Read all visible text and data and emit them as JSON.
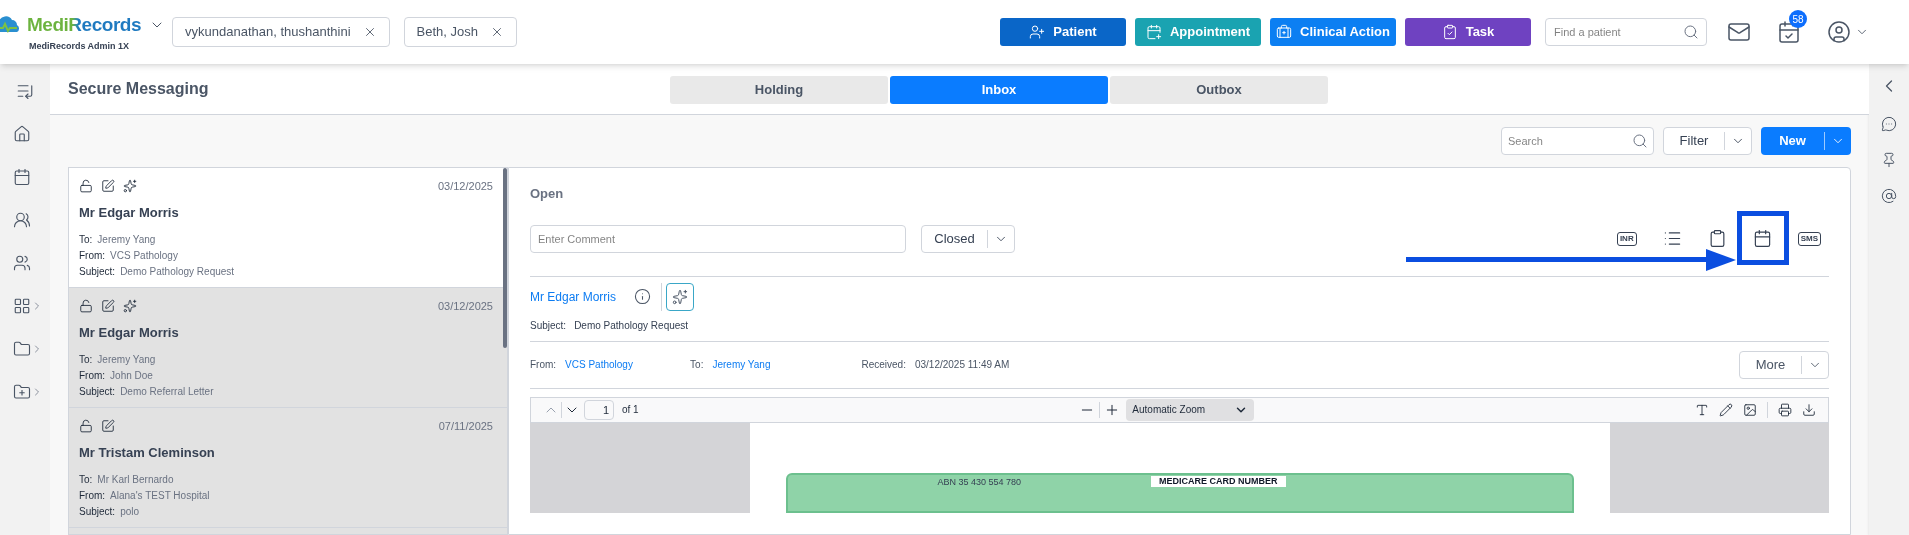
{
  "header": {
    "logo": "MediRecords",
    "account": "MediRecords Admin 1X",
    "patient_tabs": [
      "vykundanathan, thushanthini",
      "Beth, Josh"
    ],
    "actions": [
      {
        "label": "Patient",
        "kind": "patient",
        "color": "#0a66c8"
      },
      {
        "label": "Appointment",
        "kind": "appointment",
        "color": "#1aa3b1"
      },
      {
        "label": "Clinical Action",
        "kind": "clinical",
        "color": "#0c7ff2"
      },
      {
        "label": "Task",
        "kind": "task",
        "color": "#6f42c1"
      }
    ],
    "find_patient": {
      "placeholder": "Find a patient"
    },
    "task_badge": "58"
  },
  "page": {
    "title": "Secure Messaging",
    "tabs": [
      {
        "label": "Holding",
        "selected": false
      },
      {
        "label": "Inbox",
        "selected": true
      },
      {
        "label": "Outbox",
        "selected": false
      }
    ],
    "search": {
      "placeholder": "Search"
    },
    "filter": "Filter",
    "new": "New"
  },
  "messages": [
    {
      "date": "03/12/2025",
      "name": "Mr Edgar Morris",
      "ai": true,
      "selected": true,
      "fields": [
        {
          "label": "To:",
          "value": "Jeremy Yang"
        },
        {
          "label": "From:",
          "value": "VCS Pathology"
        },
        {
          "label": "Subject:",
          "value": "Demo Pathology Request"
        }
      ]
    },
    {
      "date": "03/12/2025",
      "name": "Mr Edgar Morris",
      "ai": true,
      "selected": false,
      "fields": [
        {
          "label": "To:",
          "value": "Jeremy Yang"
        },
        {
          "label": "From:",
          "value": "John Doe"
        },
        {
          "label": "Subject:",
          "value": "Demo Referral Letter"
        }
      ]
    },
    {
      "date": "07/11/2025",
      "name": "Mr Tristam Cleminson",
      "ai": false,
      "selected": false,
      "fields": [
        {
          "label": "To:",
          "value": "Mr Karl Bernardo"
        },
        {
          "label": "From:",
          "value": "Alana's TEST Hospital"
        },
        {
          "label": "Subject:",
          "value": "polo"
        }
      ]
    }
  ],
  "detail": {
    "status": "Open",
    "comment": {
      "placeholder": "Enter Comment"
    },
    "state_select": "Closed",
    "toolbar": [
      {
        "kind": "text",
        "label": "INR"
      },
      {
        "kind": "list"
      },
      {
        "kind": "clipboard"
      },
      {
        "kind": "calendar"
      },
      {
        "kind": "text",
        "label": "SMS"
      }
    ],
    "patient": "Mr Edgar Morris",
    "subject_label": "Subject:",
    "subject": "Demo Pathology Request",
    "from_label": "From:",
    "from": "VCS Pathology",
    "to_label": "To:",
    "to": "Jeremy Yang",
    "received_label": "Received:",
    "received": "03/12/2025 11:49 AM",
    "more": "More"
  },
  "pdf": {
    "page": "1",
    "page_count": "of 1",
    "zoom": "Automatic Zoom",
    "abn": "ABN 35 430 554 780",
    "card_title": "MEDICARE CARD NUMBER"
  }
}
